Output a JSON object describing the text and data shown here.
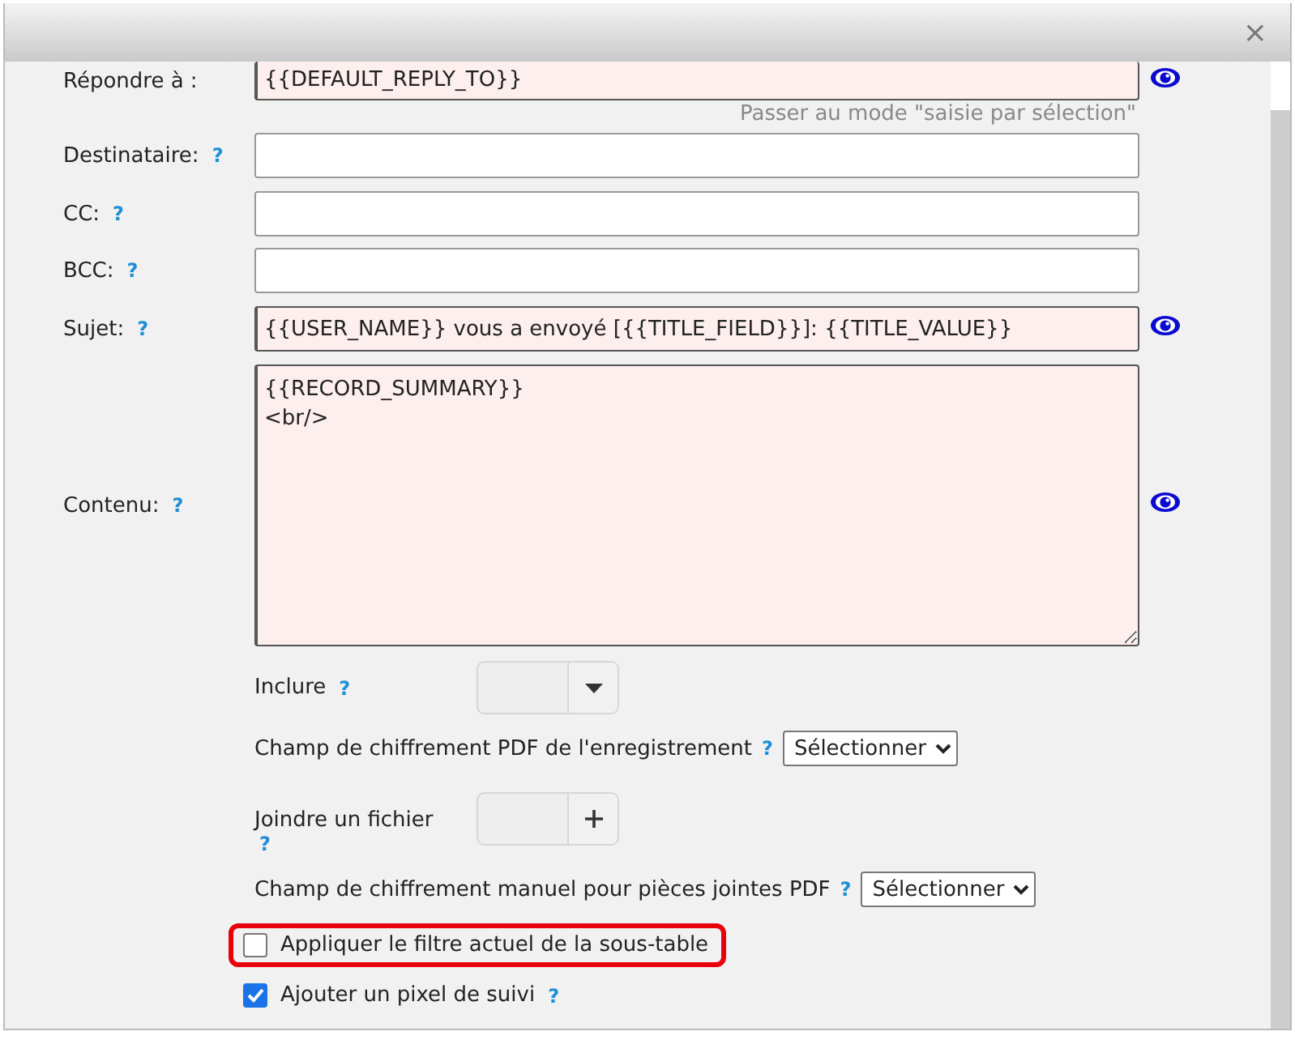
{
  "dialog": {
    "close": "×"
  },
  "fields": [
    {
      "kind": "input",
      "label": "Répondre à :",
      "value": "{{DEFAULT_REPLY_TO}}",
      "highlighted": true,
      "preview": true,
      "hint": "Passer au mode \"saisie par sélection\""
    },
    {
      "kind": "input",
      "label": "Destinataire:",
      "help": "?",
      "highlighted": false,
      "preview": false
    },
    {
      "kind": "input",
      "label": "CC:",
      "help": "?",
      "highlighted": false,
      "preview": false
    },
    {
      "kind": "input",
      "label": "BCC:",
      "help": "?",
      "highlighted": false,
      "preview": false
    },
    {
      "kind": "input",
      "label": "Sujet:",
      "help": "?",
      "value": "{{USER_NAME}} vous a envoyé [{{TITLE_FIELD}}]: {{TITLE_VALUE}}",
      "highlighted": true,
      "preview": true
    },
    {
      "kind": "textarea",
      "label": "Contenu:",
      "help": "?",
      "value": "{{RECORD_SUMMARY}}\n<br/>",
      "highlighted": true,
      "preview": true
    }
  ],
  "options": [
    {
      "kind": "dropdown",
      "label": "Inclure",
      "help": "?"
    },
    {
      "kind": "select",
      "label": "Champ de chiffrement PDF de l'enregistrement",
      "help": "?",
      "value": "Sélectionner"
    },
    {
      "kind": "attachment",
      "label": "Joindre un fichier",
      "help": "?"
    },
    {
      "kind": "select",
      "label": "Champ de chiffrement manuel pour pièces jointes PDF",
      "help": "?",
      "value": "Sélectionner"
    },
    {
      "kind": "checkbox",
      "label": "Appliquer le filtre actuel de la sous-table",
      "checked": false,
      "highlighted": true
    },
    {
      "kind": "checkbox",
      "label": "Ajouter un pixel de suivi",
      "help": "?",
      "checked": true,
      "highlighted": false
    }
  ]
}
